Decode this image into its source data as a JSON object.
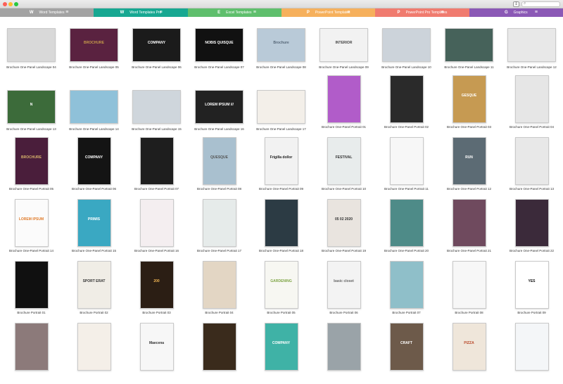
{
  "titlebar": {
    "share_icon": "share-icon",
    "search_placeholder": "",
    "search_icon": "search-icon"
  },
  "tabs": [
    {
      "letter": "W",
      "label": "Word Templates",
      "color": "#a3a3a3"
    },
    {
      "letter": "W",
      "label": "Word Templates Pro",
      "color": "#17a892"
    },
    {
      "letter": "E",
      "label": "Excel Templates",
      "color": "#5fbf6d"
    },
    {
      "letter": "P",
      "label": "PowerPoint Templates",
      "color": "#f6b05c"
    },
    {
      "letter": "P",
      "label": "PowerPoint Pro Templates",
      "color": "#f07b6f"
    },
    {
      "letter": "G",
      "label": "Graphics",
      "color": "#8b59b6"
    }
  ],
  "row1": [
    {
      "label": "Brochure One-Panel Landscape 04",
      "bg": "#d9d9d9",
      "fg": "#2b2b2b",
      "text": ""
    },
    {
      "label": "Brochure One-Panel Landscape 05",
      "bg": "#5a2240",
      "fg": "#c49a4a",
      "text": "BROCHURE"
    },
    {
      "label": "Brochure One-Panel Landscape 06",
      "bg": "#1b1b1b",
      "fg": "#ffffff",
      "text": "COMPANY"
    },
    {
      "label": "Brochure One-Panel Landscape 07",
      "bg": "#111111",
      "fg": "#ffffff",
      "text": "NOBIS QUISQUE"
    },
    {
      "label": "Brochure One-Panel Landscape 08",
      "bg": "#b9cad8",
      "fg": "#556677",
      "text": "Brochure"
    },
    {
      "label": "Brochure One-Panel Landscape 09",
      "bg": "#f2f2f2",
      "fg": "#444444",
      "text": "INTERIOR"
    },
    {
      "label": "Brochure One-Panel Landscape 10",
      "bg": "#ccd3da",
      "fg": "#ffffff",
      "text": ""
    },
    {
      "label": "Brochure One-Panel Landscape 11",
      "bg": "#46625a",
      "fg": "#ffffff",
      "text": ""
    },
    {
      "label": "Brochure One-Panel Landscape 12",
      "bg": "#e8e8e8",
      "fg": "#444444",
      "text": ""
    }
  ],
  "row2": [
    {
      "label": "Brochure One-Panel Landscape 13",
      "bg": "#3c6b3a",
      "fg": "#ffffff",
      "text": "N"
    },
    {
      "label": "Brochure One-Panel Landscape 14",
      "bg": "#8fc1d9",
      "fg": "#ffffff",
      "text": ""
    },
    {
      "label": "Brochure One-Panel Landscape 15",
      "bg": "#cfd6dc",
      "fg": "#444444",
      "text": ""
    },
    {
      "label": "Brochure One-Panel Landscape 16",
      "bg": "#222222",
      "fg": "#ffffff",
      "text": "LOREM IPSUM ///"
    },
    {
      "label": "Brochure One-Panel Landscape 17",
      "bg": "#f3efe9",
      "fg": "#555555",
      "text": ""
    },
    {
      "label": "Brochure One-Panel Portrait 01",
      "bg": "#b15cc9",
      "fg": "#ffffff",
      "text": ""
    },
    {
      "label": "Brochure One-Panel Portrait 02",
      "bg": "#2a2a2a",
      "fg": "#ffffff",
      "text": ""
    },
    {
      "label": "Brochure One-Panel Portrait 03",
      "bg": "#c69a52",
      "fg": "#ffffff",
      "text": "GESQUE"
    },
    {
      "label": "Brochure One-Panel Portrait 04",
      "bg": "#e6e6e6",
      "fg": "#222222",
      "text": ""
    }
  ],
  "row3": [
    {
      "label": "Brochure One-Panel Portrait 05",
      "bg": "#4a1e3b",
      "fg": "#d6b36b",
      "text": "BROCHURE"
    },
    {
      "label": "Brochure One-Panel Portrait 06",
      "bg": "#141414",
      "fg": "#ffffff",
      "text": "COMPANY"
    },
    {
      "label": "Brochure One-Panel Portrait 07",
      "bg": "#1e1e1e",
      "fg": "#ffffff",
      "text": ""
    },
    {
      "label": "Brochure One-Panel Portrait 08",
      "bg": "#a9c0cf",
      "fg": "#555555",
      "text": "QUESQUE"
    },
    {
      "label": "Brochure One-Panel Portrait 09",
      "bg": "#f2f2f2",
      "fg": "#222222",
      "text": "Frigilla dollor"
    },
    {
      "label": "Brochure One-Panel Portrait 10",
      "bg": "#e8ecec",
      "fg": "#333333",
      "text": "FESTIVAL"
    },
    {
      "label": "Brochure One-Panel Portrait 11",
      "bg": "#f7f7f7",
      "fg": "#4ab5bb",
      "text": ""
    },
    {
      "label": "Brochure One-Panel Portrait 12",
      "bg": "#5c6b74",
      "fg": "#ffffff",
      "text": "RUN"
    },
    {
      "label": "Brochure One-Panel Portrait 13",
      "bg": "#e8e8e8",
      "fg": "#2d8e8a",
      "text": ""
    }
  ],
  "row4": [
    {
      "label": "Brochure One-Panel Portrait 14",
      "bg": "#fbfbfb",
      "fg": "#e07b2a",
      "text": "LOREM IPSUM"
    },
    {
      "label": "Brochure One-Panel Portrait 15",
      "bg": "#3aa8c2",
      "fg": "#ffffff",
      "text": "PRIMIS"
    },
    {
      "label": "Brochure One-Panel Portrait 16",
      "bg": "#f4eef0",
      "fg": "#555555",
      "text": ""
    },
    {
      "label": "Brochure One-Panel Portrait 17",
      "bg": "#e6ebea",
      "fg": "#444444",
      "text": ""
    },
    {
      "label": "Brochure One-Panel Portrait 18",
      "bg": "#2c3b44",
      "fg": "#ffffff",
      "text": ""
    },
    {
      "label": "Brochure One-Panel Portrait 19",
      "bg": "#e9e4df",
      "fg": "#333333",
      "text": "05 02 2020"
    },
    {
      "label": "Brochure One-Panel Portrait 20",
      "bg": "#4e8b88",
      "fg": "#ffffff",
      "text": ""
    },
    {
      "label": "Brochure One-Panel Portrait 21",
      "bg": "#6f4a5e",
      "fg": "#ffffff",
      "text": ""
    },
    {
      "label": "Brochure One-Panel Portrait 22",
      "bg": "#3b2a3a",
      "fg": "#ffffff",
      "text": ""
    }
  ],
  "row5": [
    {
      "label": "Brochure Portrait 01",
      "bg": "#101010",
      "fg": "#ffffff",
      "text": ""
    },
    {
      "label": "Brochure Portrait 02",
      "bg": "#f0ede6",
      "fg": "#333333",
      "text": "SPORT ERAT"
    },
    {
      "label": "Brochure Portrait 03",
      "bg": "#2b1e14",
      "fg": "#f2b654",
      "text": "200"
    },
    {
      "label": "Brochure Portrait 04",
      "bg": "#e3d6c4",
      "fg": "#444444",
      "text": ""
    },
    {
      "label": "Brochure Portrait 05",
      "bg": "#f7f7f2",
      "fg": "#7fa546",
      "text": "GARDENING"
    },
    {
      "label": "Brochure Portrait 06",
      "bg": "#f3f3f3",
      "fg": "#666666",
      "text": "basic closet"
    },
    {
      "label": "Brochure Portrait 07",
      "bg": "#8fbfc9",
      "fg": "#ffffff",
      "text": ""
    },
    {
      "label": "Brochure Portrait 08",
      "bg": "#f7f7f7",
      "fg": "#c0392b",
      "text": ""
    },
    {
      "label": "Brochure Portrait 09",
      "bg": "#ffffff",
      "fg": "#111111",
      "text": "YES"
    }
  ],
  "row6": [
    {
      "label": "",
      "bg": "#8c7a7a",
      "fg": "#ffffff",
      "text": ""
    },
    {
      "label": "",
      "bg": "#f4efe8",
      "fg": "#555555",
      "text": ""
    },
    {
      "label": "",
      "bg": "#f7f7f7",
      "fg": "#333333",
      "text": "Maecena"
    },
    {
      "label": "",
      "bg": "#3a2b1c",
      "fg": "#e6c48a",
      "text": ""
    },
    {
      "label": "",
      "bg": "#3fb2a6",
      "fg": "#ffffff",
      "text": "COMPANY"
    },
    {
      "label": "",
      "bg": "#9aa3a8",
      "fg": "#ffffff",
      "text": ""
    },
    {
      "label": "",
      "bg": "#6d5a4a",
      "fg": "#ffffff",
      "text": "CRAFT"
    },
    {
      "label": "",
      "bg": "#efe6da",
      "fg": "#b94a2b",
      "text": "PIZZA"
    },
    {
      "label": "",
      "bg": "#f4f6f8",
      "fg": "#4a6a8a",
      "text": ""
    }
  ]
}
